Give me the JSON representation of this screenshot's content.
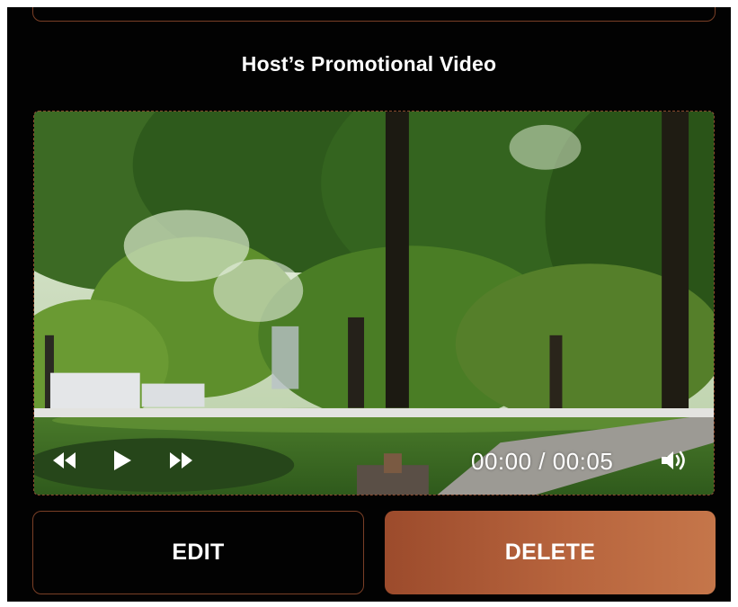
{
  "section": {
    "title": "Host’s Promotional Video"
  },
  "video": {
    "time_display": "00:00 / 00:05",
    "progress_fraction": 0,
    "controls": {
      "rewind_icon": "rewind-icon",
      "play_icon": "play-icon",
      "forward_icon": "fast-forward-icon",
      "volume_icon": "volume-icon"
    }
  },
  "actions": {
    "edit_label": "EDIT",
    "delete_label": "DELETE"
  },
  "colors": {
    "background": "#020202",
    "accent_border": "#7a3f26",
    "delete_gradient_start": "#9c4b2c",
    "delete_gradient_end": "#c5764a"
  }
}
